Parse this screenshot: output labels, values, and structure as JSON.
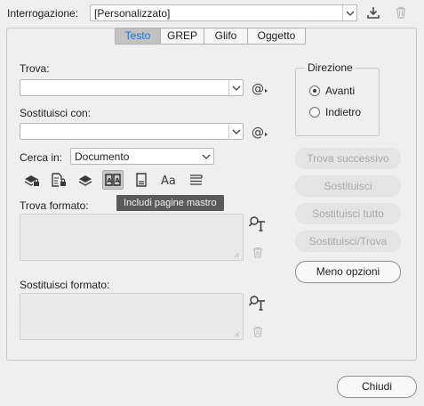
{
  "query": {
    "label": "Interrogazione:",
    "value": "[Personalizzato]",
    "save_icon": "save-query-icon",
    "delete_icon": "trash-icon"
  },
  "tabs": [
    {
      "label": "Testo",
      "active": true
    },
    {
      "label": "GREP",
      "active": false
    },
    {
      "label": "Glifo",
      "active": false
    },
    {
      "label": "Oggetto",
      "active": false
    }
  ],
  "find": {
    "label": "Trova:",
    "value": "",
    "special_icon": "at-special-chars-icon"
  },
  "replace": {
    "label": "Sostituisci con:",
    "value": "",
    "special_icon": "at-special-chars-icon"
  },
  "search_in": {
    "label": "Cerca in:",
    "value": "Documento"
  },
  "option_icons": [
    "include-locked-layers-icon",
    "include-locked-stories-icon",
    "include-hidden-layers-icon",
    "include-master-pages-icon",
    "include-footnotes-icon",
    "case-sensitive-icon",
    "whole-word-icon"
  ],
  "tooltip": "Includi pagine mastro",
  "find_format": {
    "label": "Trova formato:"
  },
  "replace_format": {
    "label": "Sostituisci formato:"
  },
  "direction": {
    "legend": "Direzione",
    "options": [
      {
        "label": "Avanti",
        "selected": true
      },
      {
        "label": "Indietro",
        "selected": false
      }
    ]
  },
  "buttons": {
    "find_next": "Trova successivo",
    "replace": "Sostituisci",
    "replace_all": "Sostituisci tutto",
    "replace_find": "Sostituisci/Trova",
    "fewer_options": "Meno opzioni",
    "close": "Chiudi"
  },
  "colors": {
    "active_tab_text": "#1a73d9",
    "tooltip_bg": "#5a5a5a"
  }
}
